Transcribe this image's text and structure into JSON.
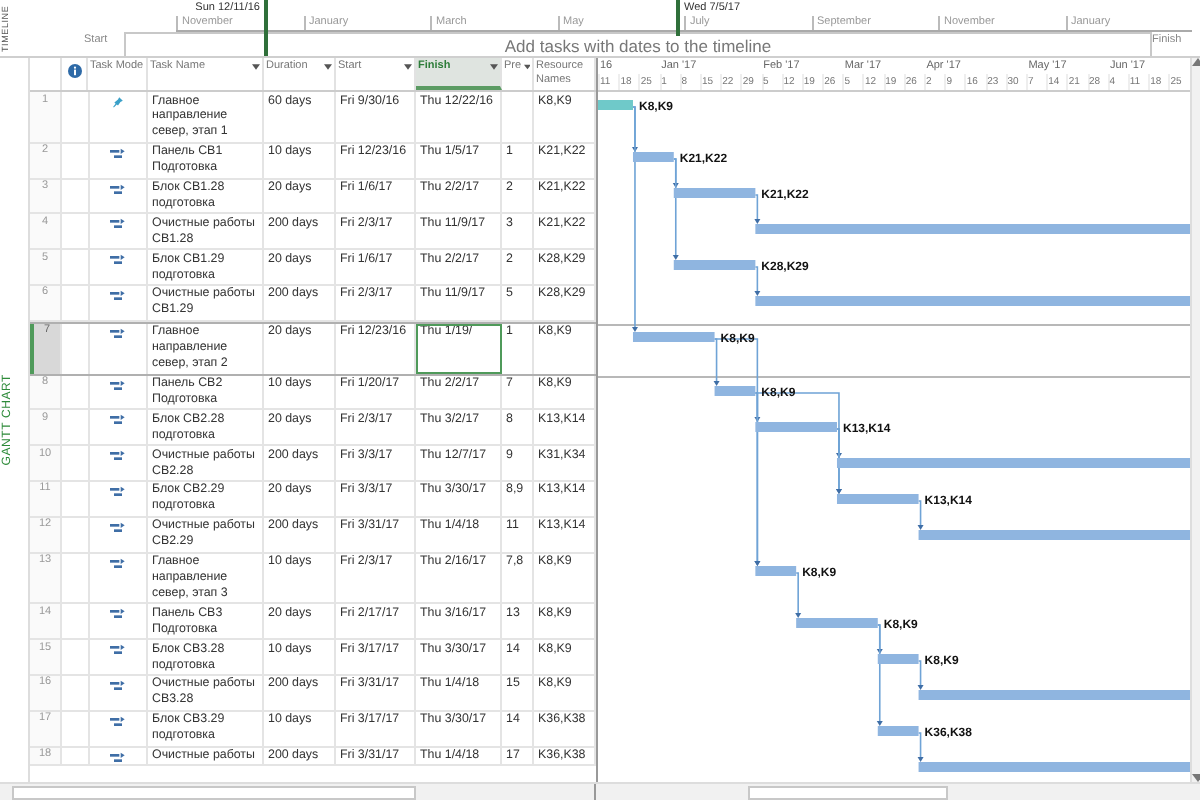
{
  "timeline": {
    "label": "TIMELINE",
    "range_start": "Sun 12/11/16",
    "range_end": "Wed 7/5/17",
    "months": [
      "November",
      "January",
      "March",
      "May",
      "July",
      "September",
      "November",
      "January"
    ],
    "start_label": "Start",
    "finish_label": "Finish",
    "placeholder": "Add tasks with dates to the timeline"
  },
  "view_label": "GANTT CHART",
  "columns": [
    {
      "kind": "info",
      "selected": false
    },
    {
      "kind": "mode",
      "label": "Task Mode",
      "selected": false
    },
    {
      "kind": "name",
      "label": "Task Name",
      "selected": false
    },
    {
      "kind": "duration",
      "label": "Duration",
      "selected": false
    },
    {
      "kind": "start",
      "label": "Start",
      "selected": false
    },
    {
      "kind": "finish",
      "label": "Finish",
      "selected": true
    },
    {
      "kind": "predecessors",
      "label": "Pre",
      "selected": false
    },
    {
      "kind": "resources",
      "label": "Resource Names",
      "selected": false
    }
  ],
  "timescale": [
    {
      "month": "16",
      "days": [
        "11",
        "18",
        "25"
      ]
    },
    {
      "month": "Jan '17",
      "days": [
        "1",
        "8",
        "15",
        "22",
        "29"
      ]
    },
    {
      "month": "Feb '17",
      "days": [
        "5",
        "12",
        "19",
        "26"
      ]
    },
    {
      "month": "Mar '17",
      "days": [
        "5",
        "12",
        "19",
        "26"
      ]
    },
    {
      "month": "Apr '17",
      "days": [
        "2",
        "9",
        "16",
        "23",
        "30"
      ]
    },
    {
      "month": "May '17",
      "days": [
        "7",
        "14",
        "21",
        "28"
      ]
    },
    {
      "month": "Jun '17",
      "days": [
        "4",
        "11",
        "18",
        "25"
      ]
    }
  ],
  "tasks": [
    {
      "id": "1",
      "kind": "manual",
      "name": "Главное направление север, этап 1",
      "duration": "60 days",
      "start": "Fri 9/30/16",
      "finish": "Thu 12/22/16",
      "resources": "K8,K9",
      "bar_label": "K8,K9",
      "selected": false
    },
    {
      "id": "2",
      "kind": "auto",
      "name": "Панель CB1 Подготовка",
      "duration": "10 days",
      "start": "Fri 12/23/16",
      "finish": "Thu 1/5/17",
      "predecessors": "1",
      "resources": "K21,K22",
      "bar_label": "K21,K22",
      "selected": false
    },
    {
      "id": "3",
      "kind": "auto",
      "name": "Блок CB1.28 подготовка",
      "duration": "20 days",
      "start": "Fri 1/6/17",
      "finish": "Thu 2/2/17",
      "predecessors": "2",
      "resources": "K21,K22",
      "bar_label": "K21,K22",
      "selected": false
    },
    {
      "id": "4",
      "kind": "auto",
      "name": "Очистные работы CB1.28",
      "duration": "200 days",
      "start": "Fri 2/3/17",
      "finish": "Thu 11/9/17",
      "predecessors": "3",
      "resources": "K21,K22",
      "selected": false
    },
    {
      "id": "5",
      "kind": "auto",
      "name": "Блок CB1.29 подготовка",
      "duration": "20 days",
      "start": "Fri 1/6/17",
      "finish": "Thu 2/2/17",
      "predecessors": "2",
      "resources": "K28,K29",
      "bar_label": "K28,K29",
      "selected": false
    },
    {
      "id": "6",
      "kind": "auto",
      "name": "Очистные работы CB1.29",
      "duration": "200 days",
      "start": "Fri 2/3/17",
      "finish": "Thu 11/9/17",
      "predecessors": "5",
      "resources": "K28,K29",
      "selected": false
    },
    {
      "id": "7",
      "kind": "auto",
      "name": "Главное направление север, этап 2",
      "duration": "20 days",
      "start": "Fri 12/23/16",
      "finish": "Thu 1/19/",
      "predecessors": "1",
      "resources": "K8,K9",
      "bar_label": "K8,K9",
      "selected": true
    },
    {
      "id": "8",
      "kind": "auto",
      "name": "Панель CB2 Подготовка",
      "duration": "10 days",
      "start": "Fri 1/20/17",
      "finish": "Thu 2/2/17",
      "predecessors": "7",
      "resources": "K8,K9",
      "bar_label": "K8,K9",
      "selected": false
    },
    {
      "id": "9",
      "kind": "auto",
      "name": "Блок CB2.28 подготовка",
      "duration": "20 days",
      "start": "Fri 2/3/17",
      "finish": "Thu 3/2/17",
      "predecessors": "8",
      "resources": "K13,K14",
      "bar_label": "K13,K14",
      "selected": false
    },
    {
      "id": "10",
      "kind": "auto",
      "name": "Очистные работы CB2.28",
      "duration": "200 days",
      "start": "Fri 3/3/17",
      "finish": "Thu 12/7/17",
      "predecessors": "9",
      "resources": "K31,K34",
      "selected": false
    },
    {
      "id": "11",
      "kind": "auto",
      "name": "Блок CB2.29 подготовка",
      "duration": "20 days",
      "start": "Fri 3/3/17",
      "finish": "Thu 3/30/17",
      "predecessors": "8,9",
      "resources": "K13,K14",
      "bar_label": "K13,K14",
      "selected": false
    },
    {
      "id": "12",
      "kind": "auto",
      "name": "Очистные работы CB2.29",
      "duration": "200 days",
      "start": "Fri 3/31/17",
      "finish": "Thu 1/4/18",
      "predecessors": "11",
      "resources": "K13,K14",
      "selected": false
    },
    {
      "id": "13",
      "kind": "auto",
      "name": "Главное направление север, этап 3",
      "duration": "10 days",
      "start": "Fri 2/3/17",
      "finish": "Thu 2/16/17",
      "predecessors": "7,8",
      "resources": "K8,K9",
      "bar_label": "K8,K9",
      "selected": false
    },
    {
      "id": "14",
      "kind": "auto",
      "name": "Панель CB3 Подготовка",
      "duration": "20 days",
      "start": "Fri 2/17/17",
      "finish": "Thu 3/16/17",
      "predecessors": "13",
      "resources": "K8,K9",
      "bar_label": "K8,K9",
      "selected": false
    },
    {
      "id": "15",
      "kind": "auto",
      "name": "Блок CB3.28 подготовка",
      "duration": "10 days",
      "start": "Fri 3/17/17",
      "finish": "Thu 3/30/17",
      "predecessors": "14",
      "resources": "K8,K9",
      "bar_label": "K8,K9",
      "selected": false
    },
    {
      "id": "16",
      "kind": "auto",
      "name": "Очистные работы CB3.28",
      "duration": "200 days",
      "start": "Fri 3/31/17",
      "finish": "Thu 1/4/18",
      "predecessors": "15",
      "resources": "K8,K9",
      "selected": false
    },
    {
      "id": "17",
      "kind": "auto",
      "name": "Блок CB3.29 подготовка",
      "duration": "10 days",
      "start": "Fri 3/17/17",
      "finish": "Thu 3/30/17",
      "predecessors": "14",
      "resources": "K36,K38",
      "bar_label": "K36,K38",
      "selected": false
    },
    {
      "id": "18",
      "kind": "auto",
      "name": "Очистные работы",
      "duration": "200 days",
      "start": "Fri 3/31/17",
      "finish": "Thu 1/4/18",
      "predecessors": "17",
      "resources": "K36,K38",
      "selected": false
    }
  ]
}
